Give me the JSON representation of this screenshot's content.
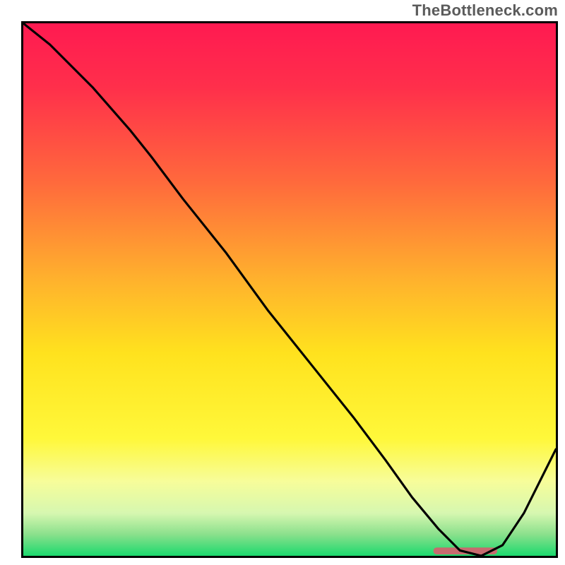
{
  "watermark": "TheBottleneck.com",
  "chart_data": {
    "type": "line",
    "title": "",
    "xlabel": "",
    "ylabel": "",
    "xlim": [
      0,
      100
    ],
    "ylim": [
      0,
      100
    ],
    "grid": false,
    "legend": false,
    "gradient_stops": [
      {
        "offset": 0.0,
        "color": "#ff1a51"
      },
      {
        "offset": 0.12,
        "color": "#ff2f4b"
      },
      {
        "offset": 0.3,
        "color": "#ff6a3c"
      },
      {
        "offset": 0.48,
        "color": "#ffb12d"
      },
      {
        "offset": 0.62,
        "color": "#ffe21e"
      },
      {
        "offset": 0.78,
        "color": "#fff83a"
      },
      {
        "offset": 0.86,
        "color": "#f7fd9a"
      },
      {
        "offset": 0.92,
        "color": "#d6f7b0"
      },
      {
        "offset": 0.96,
        "color": "#8ae08c"
      },
      {
        "offset": 1.0,
        "color": "#1bd96e"
      }
    ],
    "series": [
      {
        "name": "bottleneck-curve",
        "x": [
          0,
          5,
          13,
          20,
          24,
          30,
          38,
          46,
          54,
          62,
          68,
          73,
          78,
          82,
          86,
          90,
          94,
          100
        ],
        "y": [
          100,
          96,
          88,
          80,
          75,
          67,
          57,
          46,
          36,
          26,
          18,
          11,
          5,
          1,
          0,
          2,
          8,
          20
        ]
      }
    ],
    "annotations": [
      {
        "name": "target-bar",
        "type": "bar-segment",
        "x_start": 77,
        "x_end": 89,
        "y": 0,
        "height_pct": 1.3,
        "color": "#c76a6e"
      }
    ]
  }
}
